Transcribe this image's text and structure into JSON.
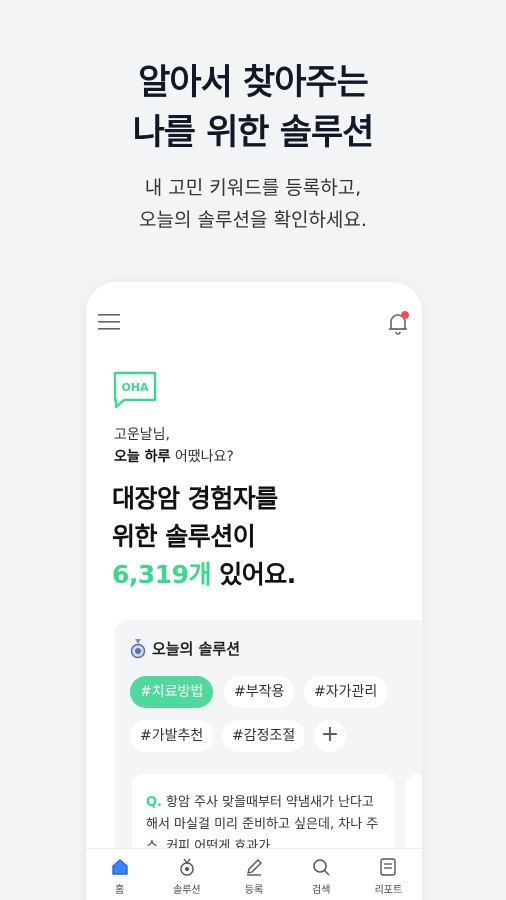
{
  "hero": {
    "line1": "알아서 찾아주는",
    "line2": "나를 위한 솔루션",
    "sub1": "내 고민 키워드를 등록하고,",
    "sub2": "오늘의 솔루션을 확인하세요."
  },
  "app": {
    "logo_text": "OHA",
    "greeting_name": "고운날님,",
    "greeting_bold": "오늘 하루",
    "greeting_rest": " 어땠나요?",
    "title_line1": "대장암 경험자를",
    "title_line2": "위한 솔루션이",
    "title_count": "6,319개",
    "title_rest": " 있어요.",
    "card_title": "오늘의 솔루션",
    "tags": [
      "#치료방법",
      "#부작용",
      "#자가관리",
      "#가발추천",
      "#감정조절"
    ],
    "plus": "+",
    "question_prefix": "Q.",
    "question_text": "항암 주사 맞을때부터 약냄새가 난다고해서 마실걸 미리 준비하고 싶은데, 차나 주스, 커피 어떤게 효과가",
    "tabs": [
      "홈",
      "솔루션",
      "등록",
      "검색",
      "리포트"
    ]
  },
  "colors": {
    "accent": "#3dd68c",
    "notification": "#ff4d4f"
  }
}
